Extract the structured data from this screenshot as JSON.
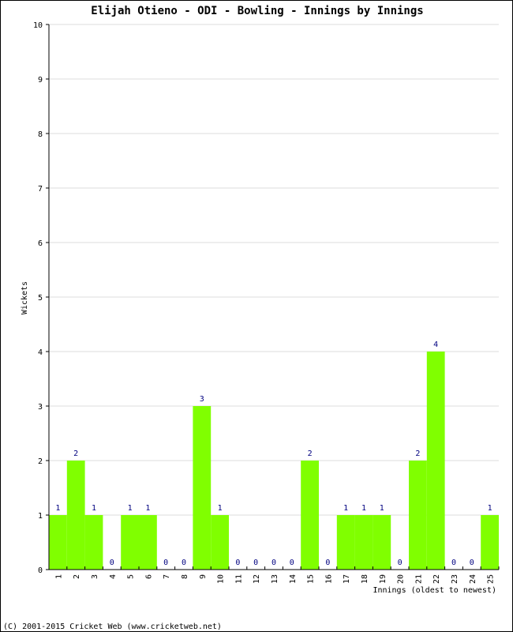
{
  "chart_data": {
    "type": "bar",
    "title": "Elijah Otieno - ODI - Bowling - Innings by Innings",
    "xlabel": "Innings (oldest to newest)",
    "ylabel": "Wickets",
    "ylim": [
      0,
      10
    ],
    "yticks": [
      0,
      1,
      2,
      3,
      4,
      5,
      6,
      7,
      8,
      9,
      10
    ],
    "grid": true,
    "categories": [
      "1",
      "2",
      "3",
      "4",
      "5",
      "6",
      "7",
      "8",
      "9",
      "10",
      "11",
      "12",
      "13",
      "14",
      "15",
      "16",
      "17",
      "18",
      "19",
      "20",
      "21",
      "22",
      "23",
      "24",
      "25"
    ],
    "values": [
      1,
      2,
      1,
      0,
      1,
      1,
      0,
      0,
      3,
      1,
      0,
      0,
      0,
      0,
      2,
      0,
      1,
      1,
      1,
      0,
      2,
      4,
      0,
      0,
      1
    ],
    "colors": {
      "bar": "#80ff00",
      "label": "#000080",
      "grid": "#dddddd",
      "axis": "#000000"
    }
  },
  "footer": {
    "copyright": "(C) 2001-2015 Cricket Web (www.cricketweb.net)"
  }
}
